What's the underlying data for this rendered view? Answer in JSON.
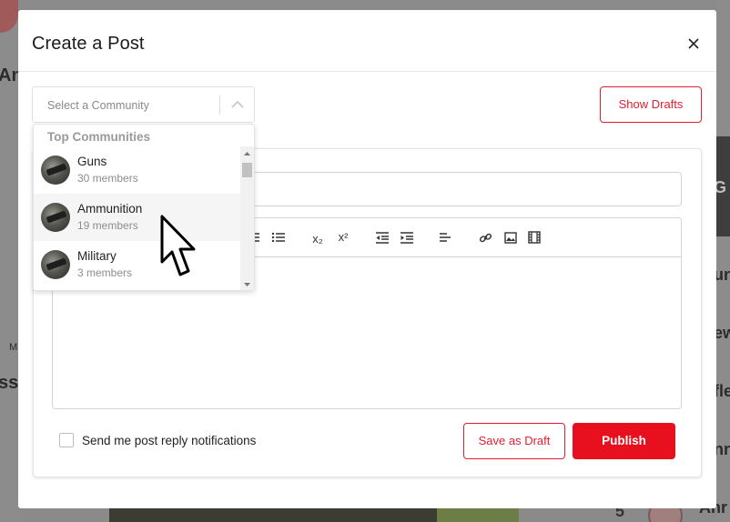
{
  "background": {
    "left_text": "An",
    "left_text_2": "ss",
    "left_text_m": "M",
    "right_text_1": "G",
    "right_text_2": "un",
    "right_text_3": "ew",
    "right_text_4": "fle",
    "right_text_5": "nn",
    "bottom_number": "5",
    "bottom_text": "Anr"
  },
  "modal": {
    "title": "Create a Post",
    "close_icon": "close-icon"
  },
  "community_select": {
    "placeholder": "Select a Community",
    "chevron_icon": "chevron-up-icon"
  },
  "show_drafts_label": "Show Drafts",
  "dropdown": {
    "header": "Top Communities",
    "items": [
      {
        "name": "Guns",
        "members": "30 members"
      },
      {
        "name": "Ammunition",
        "members": "19 members"
      },
      {
        "name": "Military",
        "members": "3 members"
      }
    ]
  },
  "toolbar": {
    "icons": [
      "bulleted-list-icon",
      "list-icon",
      "subscript-icon",
      "superscript-icon",
      "outdent-icon",
      "indent-icon",
      "align-left-icon",
      "link-icon",
      "image-icon",
      "video-icon"
    ],
    "subscript_glyph": "x₂",
    "superscript_glyph": "x²"
  },
  "notify_label": "Send me post reply notifications",
  "save_draft_label": "Save as Draft",
  "publish_label": "Publish",
  "colors": {
    "accent": "#e8101e",
    "accent_outline": "#e02030"
  }
}
